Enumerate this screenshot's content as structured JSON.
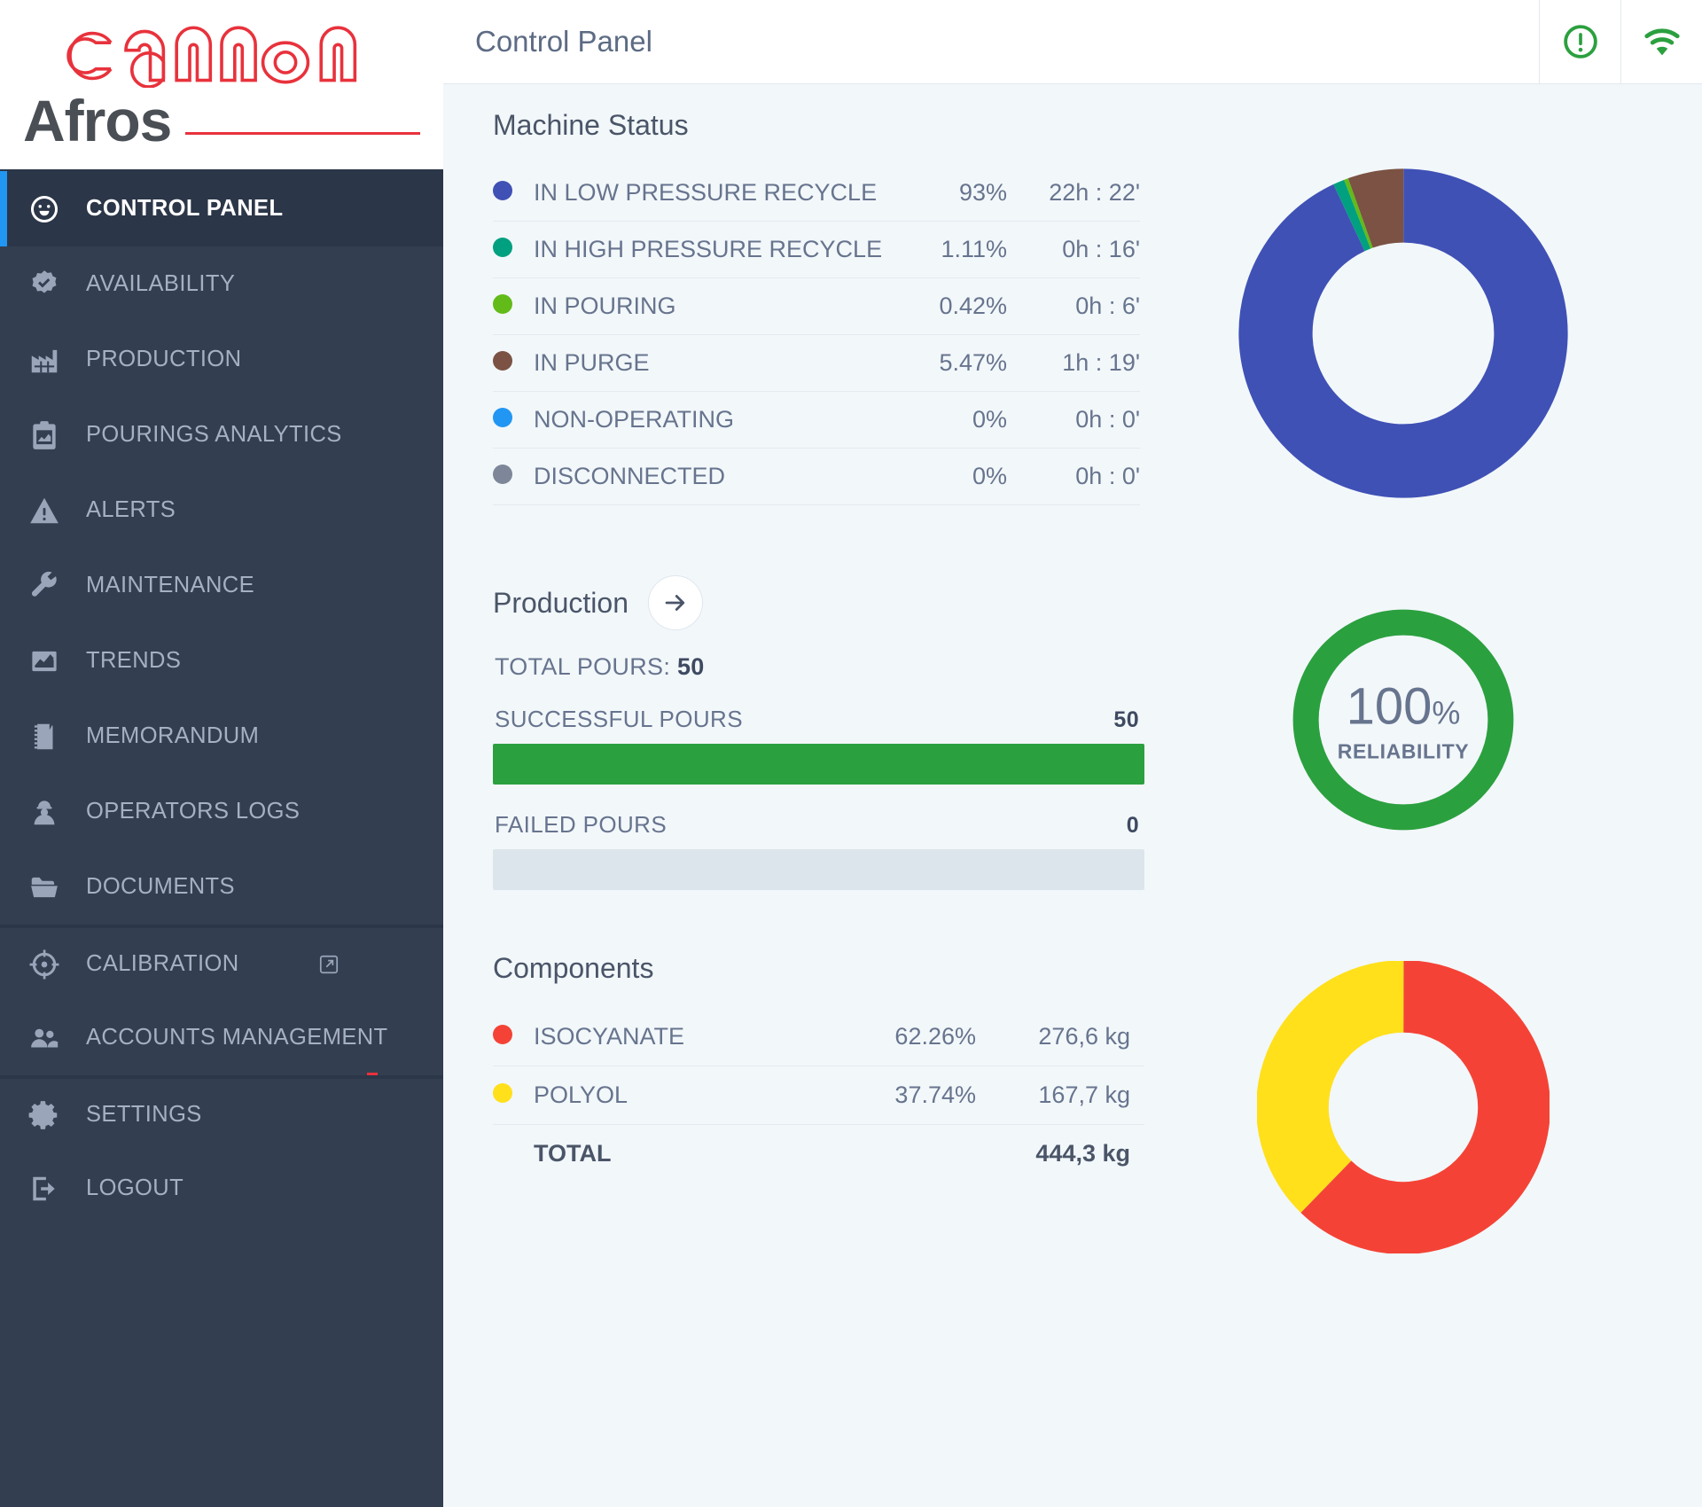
{
  "brand": {
    "logo_text": "cannon",
    "product": "Afros"
  },
  "header": {
    "title": "Control Panel",
    "alert_icon": "alert-circle-icon",
    "wifi_icon": "wifi-icon",
    "icon_color": "#2ba03f"
  },
  "sidebar": {
    "items": [
      {
        "label": "CONTROL PANEL",
        "icon": "gauge-icon",
        "active": true
      },
      {
        "label": "AVAILABILITY",
        "icon": "badge-check-icon",
        "active": false
      },
      {
        "label": "PRODUCTION",
        "icon": "factory-icon",
        "active": false
      },
      {
        "label": "POURINGS ANALYTICS",
        "icon": "clipboard-chart-icon",
        "active": false
      },
      {
        "label": "ALERTS",
        "icon": "warning-triangle-icon",
        "active": false
      },
      {
        "label": "MAINTENANCE",
        "icon": "wrench-icon",
        "active": false
      },
      {
        "label": "TRENDS",
        "icon": "line-chart-icon",
        "active": false
      },
      {
        "label": "MEMORANDUM",
        "icon": "notebook-icon",
        "active": false
      },
      {
        "label": "OPERATORS LOGS",
        "icon": "worker-icon",
        "active": false
      },
      {
        "label": "DOCUMENTS",
        "icon": "folder-icon",
        "active": false
      },
      {
        "label": "CALIBRATION",
        "icon": "crosshair-icon",
        "active": false,
        "external": true,
        "group_top": true
      },
      {
        "label": "ACCOUNTS MANAGEMENT",
        "icon": "people-icon",
        "active": false
      },
      {
        "label": "SETTINGS",
        "icon": "gear-icon",
        "active": false,
        "group_top": true
      },
      {
        "label": "LOGOUT",
        "icon": "logout-icon",
        "active": false
      }
    ]
  },
  "machine_status": {
    "title": "Machine Status",
    "rows": [
      {
        "label": "IN LOW PRESSURE RECYCLE",
        "percent": "93%",
        "time": "22h : 22'",
        "color": "#3f51b5"
      },
      {
        "label": "IN HIGH PRESSURE RECYCLE",
        "percent": "1.11%",
        "time": "0h : 16'",
        "color": "#00a080"
      },
      {
        "label": "IN POURING",
        "percent": "0.42%",
        "time": "0h : 6'",
        "color": "#62bb18"
      },
      {
        "label": "IN PURGE",
        "percent": "5.47%",
        "time": "1h : 19'",
        "color": "#7b5243"
      },
      {
        "label": "NON-OPERATING",
        "percent": "0%",
        "time": "0h : 0'",
        "color": "#2196f3"
      },
      {
        "label": "DISCONNECTED",
        "percent": "0%",
        "time": "0h : 0'",
        "color": "#7d8799"
      }
    ]
  },
  "production": {
    "title": "Production",
    "arrow_icon": "arrow-right-icon",
    "total_label": "TOTAL POURS:",
    "total_value": "50",
    "successful_label": "SUCCESSFUL POURS",
    "successful_value": "50",
    "failed_label": "FAILED POURS",
    "failed_value": "0",
    "successful_percent": 100,
    "failed_percent": 0,
    "bar_color": "#2ba03f",
    "reliability_value": "100",
    "reliability_suffix": "%",
    "reliability_label": "RELIABILITY",
    "reliability_color": "#2ba03f"
  },
  "components": {
    "title": "Components",
    "rows": [
      {
        "label": "ISOCYANATE",
        "percent": "62.26%",
        "mass": "276,6 kg",
        "color": "#f44336"
      },
      {
        "label": "POLYOL",
        "percent": "37.74%",
        "mass": "167,7 kg",
        "color": "#ffe01b"
      }
    ],
    "total_label": "TOTAL",
    "total_mass": "444,3 kg"
  },
  "chart_data": [
    {
      "type": "pie",
      "title": "Machine Status",
      "categories": [
        "IN LOW PRESSURE RECYCLE",
        "IN HIGH PRESSURE RECYCLE",
        "IN POURING",
        "IN PURGE",
        "NON-OPERATING",
        "DISCONNECTED"
      ],
      "values": [
        93,
        1.11,
        0.42,
        5.47,
        0,
        0
      ],
      "colors": [
        "#3f51b5",
        "#00a080",
        "#62bb18",
        "#7b5243",
        "#2196f3",
        "#7d8799"
      ],
      "donut": true,
      "legend": "left"
    },
    {
      "type": "pie",
      "title": "RELIABILITY",
      "categories": [
        "RELIABILITY"
      ],
      "values": [
        100
      ],
      "colors": [
        "#2ba03f"
      ],
      "donut": true,
      "center_label": "100%"
    },
    {
      "type": "pie",
      "title": "Components",
      "categories": [
        "ISOCYANATE",
        "POLYOL"
      ],
      "values": [
        62.26,
        37.74
      ],
      "colors": [
        "#f44336",
        "#ffe01b"
      ],
      "donut": true,
      "legend": "left"
    },
    {
      "type": "bar",
      "title": "Production pours",
      "categories": [
        "SUCCESSFUL POURS",
        "FAILED POURS"
      ],
      "values": [
        50,
        0
      ],
      "ylim": [
        0,
        50
      ],
      "colors": [
        "#2ba03f",
        "#dde5ec"
      ]
    }
  ]
}
